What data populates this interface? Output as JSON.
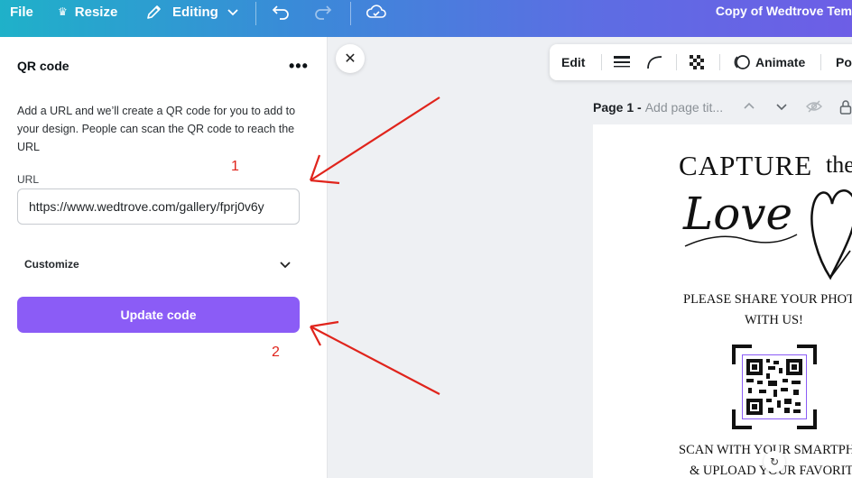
{
  "topbar": {
    "file_label": "File",
    "resize_label": "Resize",
    "editing_label": "Editing",
    "doc_title": "Copy of Wedtrove Tem"
  },
  "panel": {
    "title": "QR code",
    "description": "Add a URL and we’ll create a QR code for you to add to your design. People can scan the QR code to reach the URL",
    "url_label": "URL",
    "url_value": "https://www.wedtrove.com/gallery/fprj0v6y",
    "customize_label": "Customize",
    "update_button": "Update code"
  },
  "context_toolbar": {
    "edit_label": "Edit",
    "animate_label": "Animate",
    "position_label": "Po"
  },
  "page_header": {
    "page_label": "Page 1 -",
    "title_placeholder": "Add page tit..."
  },
  "design": {
    "capture": "CAPTURE",
    "the": "the",
    "love": "Love",
    "share_line1": "PLEASE SHARE YOUR PHOTO",
    "share_line2": "WITH US!",
    "scan_line1": "SCAN WITH YOUR SMARTPHO",
    "scan_line2": "& UPLOAD YOUR FAVORITE"
  },
  "annotations": {
    "step1": "1",
    "step2": "2"
  },
  "colors": {
    "accent": "#8b5cf6",
    "annotation": "#e0241c"
  },
  "icons": [
    "crown-icon",
    "pencil-icon",
    "chevron-down-icon",
    "undo-icon",
    "redo-icon",
    "cloud-sync-icon",
    "more-icon",
    "close-icon",
    "line-weight-icon",
    "corner-icon",
    "transparency-icon",
    "animate-icon",
    "qr-code-icon",
    "rotate-icon"
  ]
}
